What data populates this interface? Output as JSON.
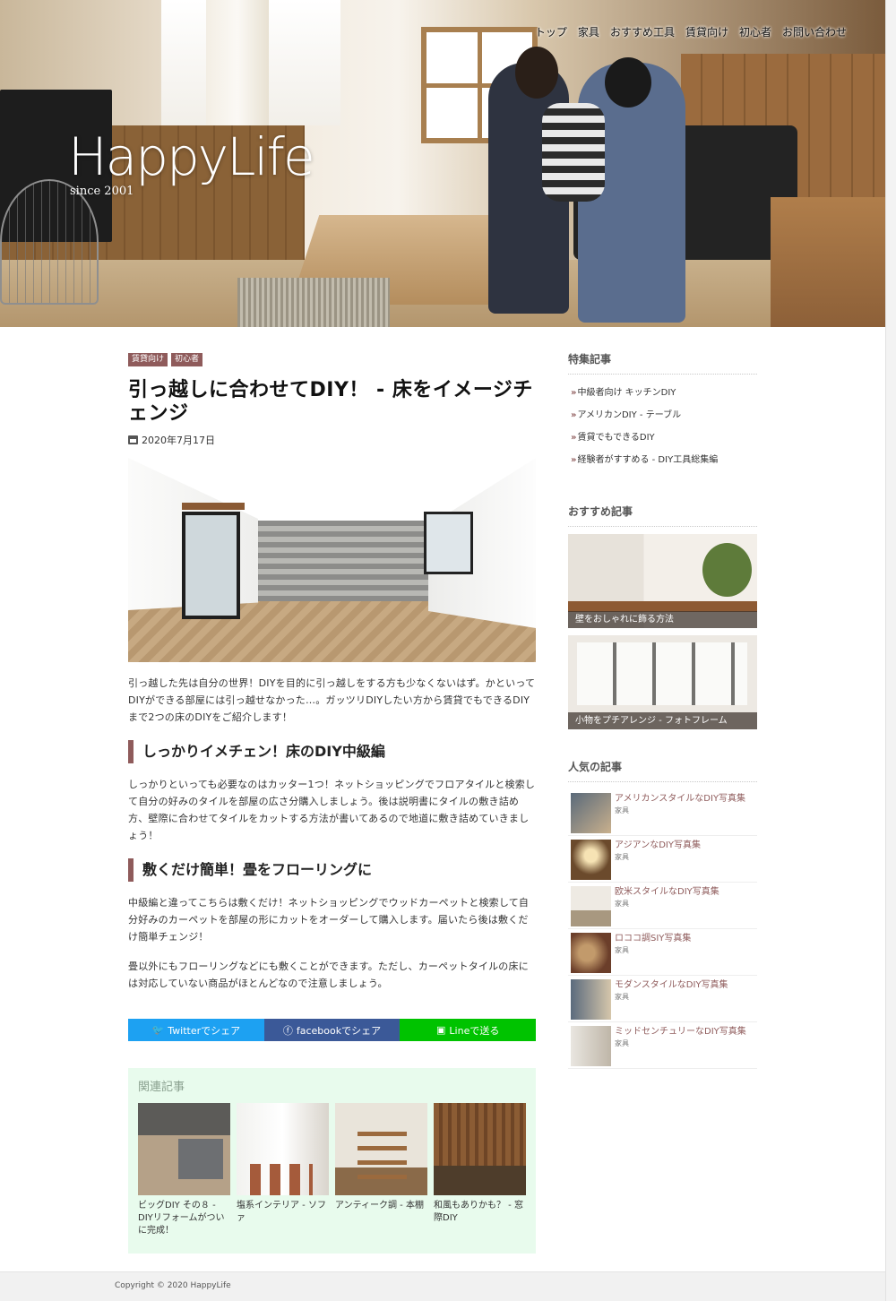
{
  "brand": {
    "name": "HappyLife",
    "since": "since 2001"
  },
  "nav": [
    "トップ",
    "家具",
    "おすすめ工具",
    "賃貸向け",
    "初心者",
    "お問い合わせ"
  ],
  "article": {
    "tags": [
      "賃貸向け",
      "初心者"
    ],
    "title": "引っ越しに合わせてDIY！ - 床をイメージチェンジ",
    "date": "2020年7月17日",
    "intro": "引っ越した先は自分の世界！DIYを目的に引っ越しをする方も少なくないはず。かといってDIYができる部屋には引っ越せなかった…。ガッツリDIYしたい方から賃貸でもできるDIYまで2つの床のDIYをご紹介します！",
    "section1": {
      "heading": "しっかりイメチェン！床のDIY中級編",
      "body": "しっかりといっても必要なのはカッター1つ！ネットショッピングでフロアタイルと検索して自分の好みのタイルを部屋の広さ分購入しましょう。後は説明書にタイルの敷き詰め方、壁際に合わせてタイルをカットする方法が書いてあるので地道に敷き詰めていきましょう！"
    },
    "section2": {
      "heading": "敷くだけ簡単！畳をフローリングに",
      "body1": "中級編と違ってこちらは敷くだけ！ネットショッピングでウッドカーペットと検索して自分好みのカーペットを部屋の形にカットをオーダーして購入します。届いたら後は敷くだけ簡単チェンジ！",
      "body2": "畳以外にもフローリングなどにも敷くことができます。ただし、カーペットタイルの床には対応していない商品がほとんどなので注意しましょう。"
    }
  },
  "share": {
    "twitter": "Twitterでシェア",
    "facebook": "facebookでシェア",
    "line": "Lineで送る",
    "colors": {
      "twitter": "#1da1f2",
      "facebook": "#3b5998",
      "line": "#00c300"
    }
  },
  "related": {
    "heading": "関連記事",
    "items": [
      "ビッグDIY その８ - DIYリフォームがついに完成！",
      "塩系インテリア - ソファ",
      "アンティーク調 - 本棚",
      "和風もありかも？ - 窓際DIY"
    ]
  },
  "sidebar": {
    "featured": {
      "heading": "特集記事",
      "items": [
        "中級者向け キッチンDIY",
        "アメリカンDIY - テーブル",
        "賃貸でもできるDIY",
        "経験者がすすめる - DIY工具総集編"
      ]
    },
    "recommended": {
      "heading": "おすすめ記事",
      "items": [
        "壁をおしゃれに飾る方法",
        "小物をプチアレンジ - フォトフレーム"
      ]
    },
    "popular": {
      "heading": "人気の記事",
      "items": [
        {
          "title": "アメリカンスタイルなDIY写真集",
          "category": "家具"
        },
        {
          "title": "アジアンなDIY写真集",
          "category": "家具"
        },
        {
          "title": "欧米スタイルなDIY写真集",
          "category": "家具"
        },
        {
          "title": "ロココ調SIY写真集",
          "category": "家具"
        },
        {
          "title": "モダンスタイルなDIY写真集",
          "category": "家具"
        },
        {
          "title": "ミッドセンチュリーなDIY写真集",
          "category": "家具"
        }
      ]
    }
  },
  "footer": {
    "copyright": "Copyright © 2020 HappyLife"
  },
  "accent_color": "#8f5b5b"
}
